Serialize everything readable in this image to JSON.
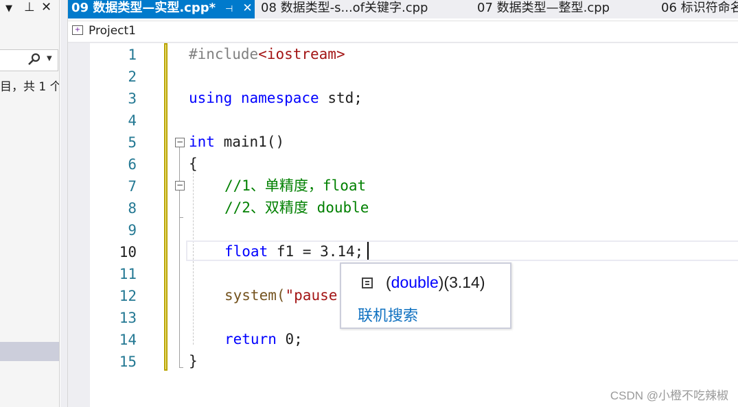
{
  "left_panel": {
    "dropdown_icon": "▼",
    "pin_icon": "⊥",
    "close_icon": "✕",
    "search_icon": "search",
    "count_text": "目，共 1 个"
  },
  "tabs": [
    {
      "label": "09 数据类型—实型.cpp*",
      "active": true
    },
    {
      "label": "08 数据类型-s...of关键字.cpp",
      "active": false
    },
    {
      "label": "07 数据类型—整型.cpp",
      "active": false
    },
    {
      "label": "06 标识符命名",
      "active": false
    }
  ],
  "navbar": {
    "project": "Project1"
  },
  "editor": {
    "line_numbers": [
      "1",
      "2",
      "3",
      "4",
      "5",
      "6",
      "7",
      "8",
      "9",
      "10",
      "11",
      "12",
      "13",
      "14",
      "15"
    ],
    "current_line": "10",
    "lines": {
      "l1_pp": "#include",
      "l1_inc": "<iostream>",
      "l3_kw1": "using",
      "l3_kw2": "namespace",
      "l3_rest": " std;",
      "l5_kw": "int",
      "l5_rest": " main1()",
      "l6": "{",
      "l7": "//1、单精度，float",
      "l8": "//2、双精度 double",
      "l10_kw": "float",
      "l10_rest": " f1 = 3.14;",
      "l12_fn": "system(",
      "l12_str": "\"pause",
      "l14_kw": "return",
      "l14_rest": " 0;",
      "l15": "}"
    }
  },
  "tooltip": {
    "type": "double",
    "open_paren": "(",
    "close_cast": ")",
    "value": "(3.14)",
    "link": "联机搜索"
  },
  "watermark": "CSDN @小橙不吃辣椒"
}
